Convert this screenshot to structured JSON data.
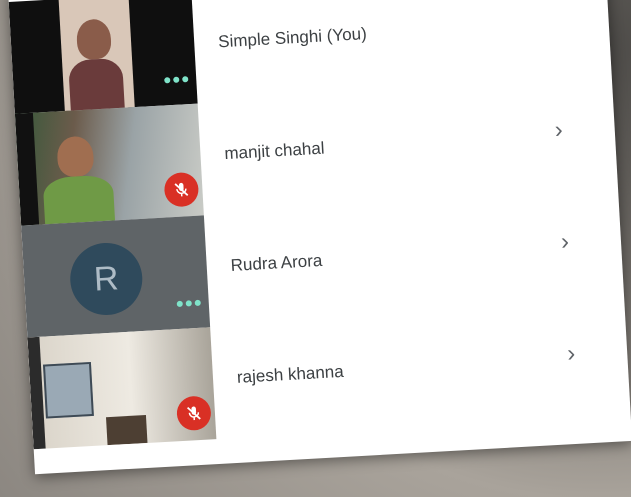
{
  "participants": [
    {
      "name": "Simple Singhi (You)",
      "state": "more-options"
    },
    {
      "name": "manjit chahal",
      "state": "muted",
      "chevron": "›"
    },
    {
      "name": "Rudra Arora",
      "state": "more-options",
      "avatar_letter": "R",
      "chevron": "›"
    },
    {
      "name": "rajesh khanna",
      "state": "muted",
      "chevron": "›"
    }
  ],
  "icons": {
    "chevron": "chevron-right-icon",
    "more": "more-dots-icon",
    "mute": "mic-off-icon"
  },
  "colors": {
    "panel": "#ffffff",
    "accent": "#1a8078",
    "mute_red": "#d93025",
    "dots_teal": "#7fe3c9",
    "avatar_bg": "#2f4a5c",
    "name_text": "#3c4043"
  }
}
